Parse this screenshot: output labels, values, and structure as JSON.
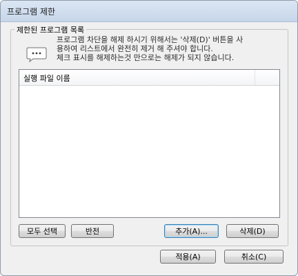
{
  "window": {
    "title": "프로그램 제한"
  },
  "group": {
    "legend": "제한된 프로그램 목록",
    "info_icon": "speech-bubble-icon",
    "info_lines": [
      "프로그램 차단을 해제 하시기 위해서는 '삭제(D)' 버튼을 사",
      "용하여 리스트에서 완전히 제거 해 주셔야 합니다.",
      "체크 표시를 해제하는것 만으로는 해제가 되지 않습니다."
    ]
  },
  "list": {
    "columns": [
      "실행 파일 이름",
      ""
    ],
    "rows": []
  },
  "buttons": {
    "select_all": "모두 선택",
    "invert": "반전",
    "add": "추가(A)...",
    "delete": "삭제(D)",
    "apply": "적용(A)",
    "cancel": "취소(C)"
  }
}
